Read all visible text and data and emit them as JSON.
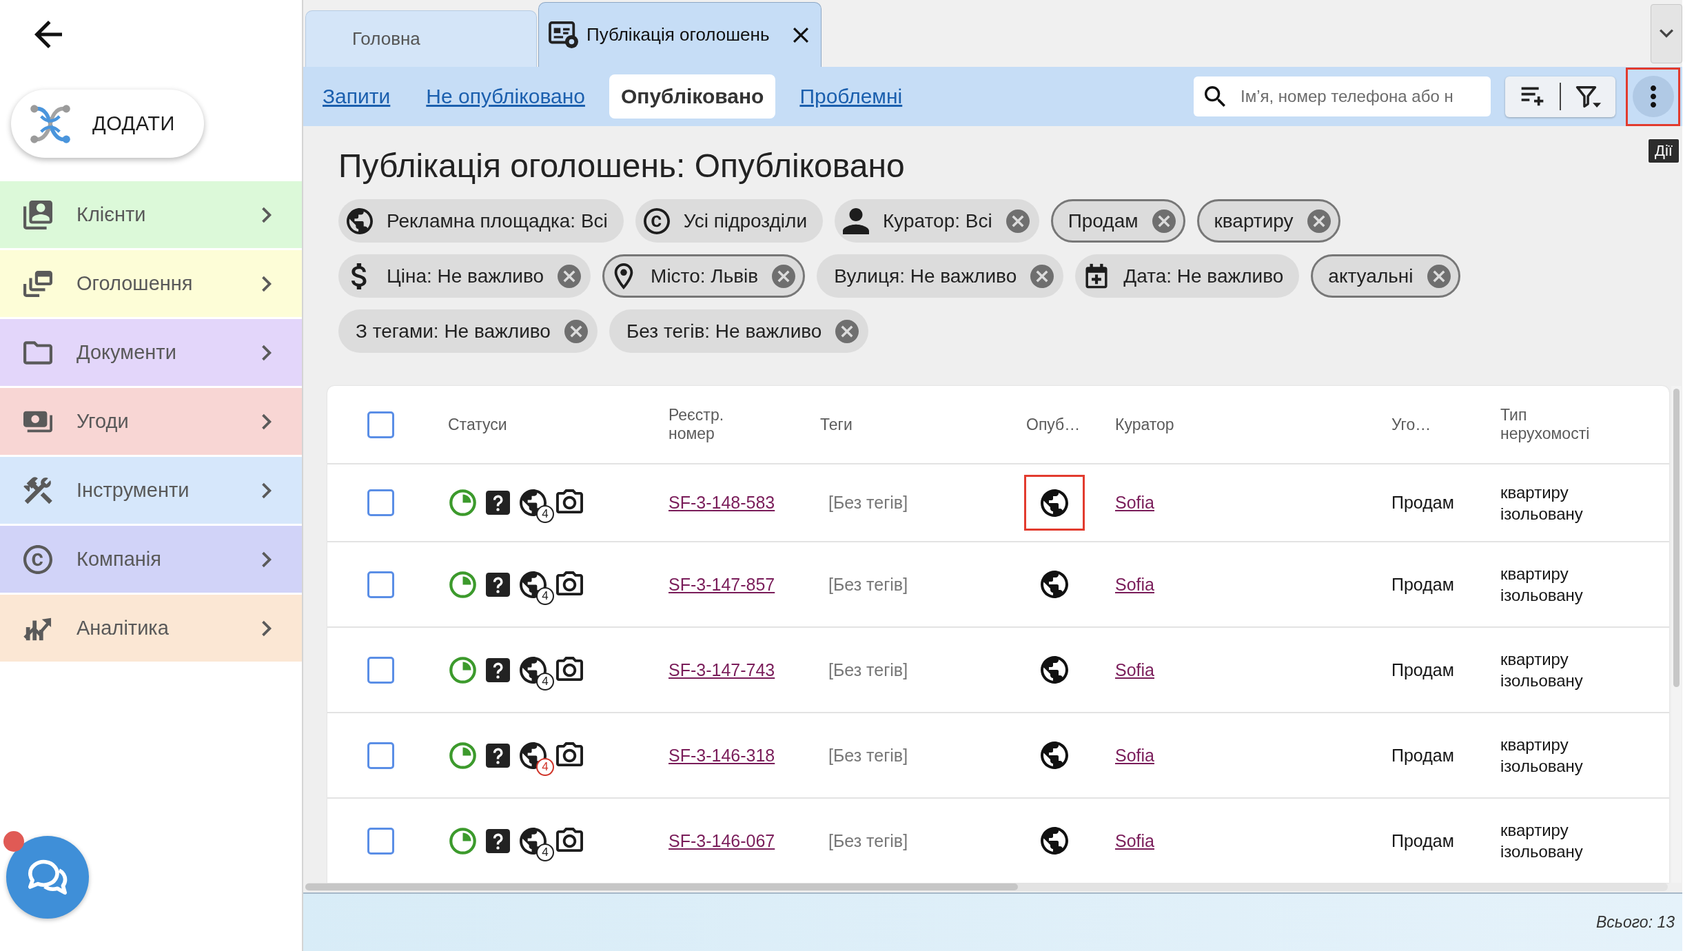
{
  "sidebar": {
    "add_button": {
      "label": "ДОДАТИ"
    },
    "menu": [
      {
        "kind": "clients",
        "label": "Клієнти",
        "color": "#dcf9d9"
      },
      {
        "kind": "ads",
        "label": "Оголошення",
        "color": "#fdfdd7"
      },
      {
        "kind": "documents",
        "label": "Документи",
        "color": "#e3d6fa"
      },
      {
        "kind": "deals",
        "label": "Угоди",
        "color": "#f8d6d4"
      },
      {
        "kind": "tools",
        "label": "Інструменти",
        "color": "#d6e7fb"
      },
      {
        "kind": "company",
        "label": "Компанія",
        "color": "#d1d3f8"
      },
      {
        "kind": "analytics",
        "label": "Аналітика",
        "color": "#fbe7d4"
      }
    ]
  },
  "chat": {
    "unread": true
  },
  "tabs": [
    {
      "kind": "home",
      "label": "Головна",
      "selected": false,
      "closable": false
    },
    {
      "kind": "page",
      "label": "Публікація оголошень",
      "selected": true,
      "closable": true
    }
  ],
  "toolbar": {
    "views": [
      {
        "label": "Запити",
        "selected": false
      },
      {
        "label": "Не опубліковано",
        "selected": false
      },
      {
        "label": "Опубліковано",
        "selected": true
      },
      {
        "label": "Проблемні",
        "selected": false
      }
    ],
    "search": {
      "placeholder": "Ім’я, номер телефона або н"
    },
    "actions_button": {
      "highlighted": true,
      "tooltip": "Дії"
    }
  },
  "page": {
    "title": "Публікація оголошень: Опубліковано",
    "filters": [
      {
        "kind": "globe",
        "label": "Рекламна площадка: Всі",
        "outlined": false,
        "removable": false
      },
      {
        "kind": "company",
        "label": "Усі підрозділи",
        "outlined": false,
        "removable": false
      },
      {
        "kind": "person",
        "label": "Куратор: Всі",
        "outlined": false,
        "removable": true
      },
      {
        "kind": "plain",
        "label": "Продам",
        "outlined": true,
        "removable": true
      },
      {
        "kind": "plain",
        "label": "квартиру",
        "outlined": true,
        "removable": true
      },
      {
        "kind": "dollar",
        "label": "Ціна: Не важливо",
        "outlined": false,
        "removable": true
      },
      {
        "kind": "pin",
        "label": "Місто: Львів",
        "outlined": true,
        "removable": true
      },
      {
        "kind": "plain",
        "label": "Вулиця: Не важливо",
        "outlined": false,
        "removable": true
      },
      {
        "kind": "calendar",
        "label": "Дата: Не важливо",
        "outlined": false,
        "removable": false
      },
      {
        "kind": "plain",
        "label": "актуальні",
        "outlined": true,
        "removable": true
      },
      {
        "kind": "plain",
        "label": "З тегами: Не важливо",
        "outlined": false,
        "removable": true
      },
      {
        "kind": "plain",
        "label": "Без тегів: Не важливо",
        "outlined": false,
        "removable": true
      }
    ]
  },
  "table": {
    "select_all": {
      "checked": false
    },
    "columns": [
      "Статуси",
      "Реєстр. номер",
      "Теги",
      "Опуб…",
      "Куратор",
      "Уго…",
      "Тип нерухомості"
    ],
    "rows": [
      {
        "checked": false,
        "portals_badge": {
          "text": "4",
          "alert": false
        },
        "reg_number": "SF-3-148-583",
        "tags": "[Без тегів]",
        "published_highlighted": true,
        "curator": "Sofia",
        "deal": "Продам",
        "property_type": "квартиру ізольовану"
      },
      {
        "checked": false,
        "portals_badge": {
          "text": "4",
          "alert": false
        },
        "reg_number": "SF-3-147-857",
        "tags": "[Без тегів]",
        "published_highlighted": false,
        "curator": "Sofia",
        "deal": "Продам",
        "property_type": "квартиру ізольовану"
      },
      {
        "checked": false,
        "portals_badge": {
          "text": "4",
          "alert": false
        },
        "reg_number": "SF-3-147-743",
        "tags": "[Без тегів]",
        "published_highlighted": false,
        "curator": "Sofia",
        "deal": "Продам",
        "property_type": "квартиру ізольовану"
      },
      {
        "checked": false,
        "portals_badge": {
          "text": "4",
          "alert": true
        },
        "reg_number": "SF-3-146-318",
        "tags": "[Без тегів]",
        "published_highlighted": false,
        "curator": "Sofia",
        "deal": "Продам",
        "property_type": "квартиру ізольовану"
      },
      {
        "checked": false,
        "portals_badge": {
          "text": "4",
          "alert": false
        },
        "reg_number": "SF-3-146-067",
        "tags": "[Без тегів]",
        "published_highlighted": false,
        "curator": "Sofia",
        "deal": "Продам",
        "property_type": "квартиру ізольовану"
      }
    ]
  },
  "footer": {
    "total": "Всього: 13"
  }
}
